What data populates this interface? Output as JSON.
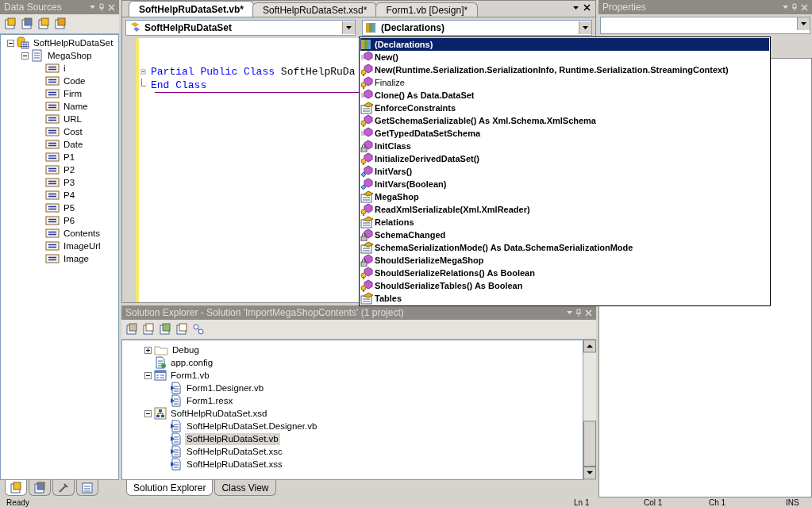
{
  "data_sources": {
    "title": "Data Sources",
    "tree": [
      {
        "label": "SoftHelpRuDataSet",
        "kind": "dataset",
        "expanded": true,
        "children": [
          {
            "label": "MegaShop",
            "kind": "table",
            "expanded": true,
            "children": [
              {
                "label": "i",
                "kind": "column"
              },
              {
                "label": "Code",
                "kind": "column"
              },
              {
                "label": "Firm",
                "kind": "column"
              },
              {
                "label": "Name",
                "kind": "column"
              },
              {
                "label": "URL",
                "kind": "column"
              },
              {
                "label": "Cost",
                "kind": "column"
              },
              {
                "label": "Date",
                "kind": "column"
              },
              {
                "label": "P1",
                "kind": "column"
              },
              {
                "label": "P2",
                "kind": "column"
              },
              {
                "label": "P3",
                "kind": "column"
              },
              {
                "label": "P4",
                "kind": "column"
              },
              {
                "label": "P5",
                "kind": "column"
              },
              {
                "label": "P6",
                "kind": "column"
              },
              {
                "label": "Contents",
                "kind": "column"
              },
              {
                "label": "ImageUrl",
                "kind": "column"
              },
              {
                "label": "Image",
                "kind": "column"
              }
            ]
          }
        ]
      }
    ]
  },
  "editor": {
    "tabs": [
      {
        "label": "SoftHelpRuDataSet.vb*",
        "selected": true
      },
      {
        "label": "SoftHelpRuDataSet.xsd*",
        "selected": false
      },
      {
        "label": "Form1.vb [Design]*",
        "selected": false
      }
    ],
    "class_combo": "SoftHelpRuDataSet",
    "member_combo": "(Declarations)",
    "code_lines": [
      {
        "kind": "block_start",
        "tokens": [
          {
            "text": "Partial Public Class",
            "kind": "keyword"
          },
          {
            "text": "SoftHelpRuDa",
            "kind": "identifier"
          }
        ]
      },
      {
        "kind": "block_end",
        "tokens": [
          {
            "text": "End Class",
            "kind": "keyword"
          }
        ]
      }
    ]
  },
  "member_list": [
    {
      "label": "(Declarations)",
      "kind": "declarations",
      "bold": true,
      "selected": true
    },
    {
      "label": "New()",
      "kind": "public_method",
      "bold": true,
      "selected": false
    },
    {
      "label": "New(Runtime.Serialization.SerializationInfo, Runtime.Serialization.StreamingContext)",
      "kind": "protected_method",
      "bold": true,
      "selected": false
    },
    {
      "label": "Finalize",
      "kind": "protected_method",
      "bold": false,
      "selected": false
    },
    {
      "label": "Clone() As Data.DataSet",
      "kind": "public_method",
      "bold": true,
      "selected": false
    },
    {
      "label": "EnforceConstraints",
      "kind": "property",
      "bold": true,
      "selected": false
    },
    {
      "label": "GetSchemaSerializable() As Xml.Schema.XmlSchema",
      "kind": "protected_method",
      "bold": true,
      "selected": false
    },
    {
      "label": "GetTypedDataSetSchema",
      "kind": "public_method",
      "bold": true,
      "selected": false
    },
    {
      "label": "InitClass",
      "kind": "private_method",
      "bold": true,
      "selected": false
    },
    {
      "label": "InitializeDerivedDataSet()",
      "kind": "protected_method",
      "bold": true,
      "selected": false
    },
    {
      "label": "InitVars()",
      "kind": "friend_method",
      "bold": true,
      "selected": false
    },
    {
      "label": "InitVars(Boolean)",
      "kind": "friend_method",
      "bold": true,
      "selected": false
    },
    {
      "label": "MegaShop",
      "kind": "property",
      "bold": true,
      "selected": false
    },
    {
      "label": "ReadXmlSerializable(Xml.XmlReader)",
      "kind": "protected_method",
      "bold": true,
      "selected": false
    },
    {
      "label": "Relations",
      "kind": "property",
      "bold": true,
      "selected": false
    },
    {
      "label": "SchemaChanged",
      "kind": "private_method",
      "bold": true,
      "selected": false
    },
    {
      "label": "SchemaSerializationMode() As Data.SchemaSerializationMode",
      "kind": "property",
      "bold": true,
      "selected": false
    },
    {
      "label": "ShouldSerializeMegaShop",
      "kind": "private_method",
      "bold": true,
      "selected": false
    },
    {
      "label": "ShouldSerializeRelations() As Boolean",
      "kind": "protected_method",
      "bold": true,
      "selected": false
    },
    {
      "label": "ShouldSerializeTables() As Boolean",
      "kind": "protected_method",
      "bold": true,
      "selected": false
    },
    {
      "label": "Tables",
      "kind": "property",
      "bold": true,
      "selected": false
    }
  ],
  "solution_explorer": {
    "title": "Solution Explorer - Solution 'ImportMegaShopContents' (1 project)",
    "tree": [
      {
        "label": "Debug",
        "kind": "folder",
        "expanded": false,
        "selected": false
      },
      {
        "label": "app.config",
        "kind": "config",
        "selected": false
      },
      {
        "label": "Form1.vb",
        "kind": "form",
        "expanded": true,
        "selected": false,
        "children": [
          {
            "label": "Form1.Designer.vb",
            "kind": "code",
            "selected": false
          },
          {
            "label": "Form1.resx",
            "kind": "code",
            "selected": false
          }
        ]
      },
      {
        "label": "SoftHelpRuDataSet.xsd",
        "kind": "schema",
        "expanded": true,
        "selected": false,
        "children": [
          {
            "label": "SoftHelpRuDataSet.Designer.vb",
            "kind": "code",
            "selected": false
          },
          {
            "label": "SoftHelpRuDataSet.vb",
            "kind": "code",
            "selected": true
          },
          {
            "label": "SoftHelpRuDataSet.xsc",
            "kind": "code",
            "selected": false
          },
          {
            "label": "SoftHelpRuDataSet.xss",
            "kind": "code",
            "selected": false
          }
        ]
      }
    ],
    "tabs": [
      {
        "label": "Solution Explorer",
        "selected": true
      },
      {
        "label": "Class View",
        "selected": false
      }
    ]
  },
  "properties": {
    "title": "Properties"
  },
  "status_bar": [
    "Ready",
    "Ln 1",
    "Col 1",
    "Ch 1",
    "INS"
  ]
}
